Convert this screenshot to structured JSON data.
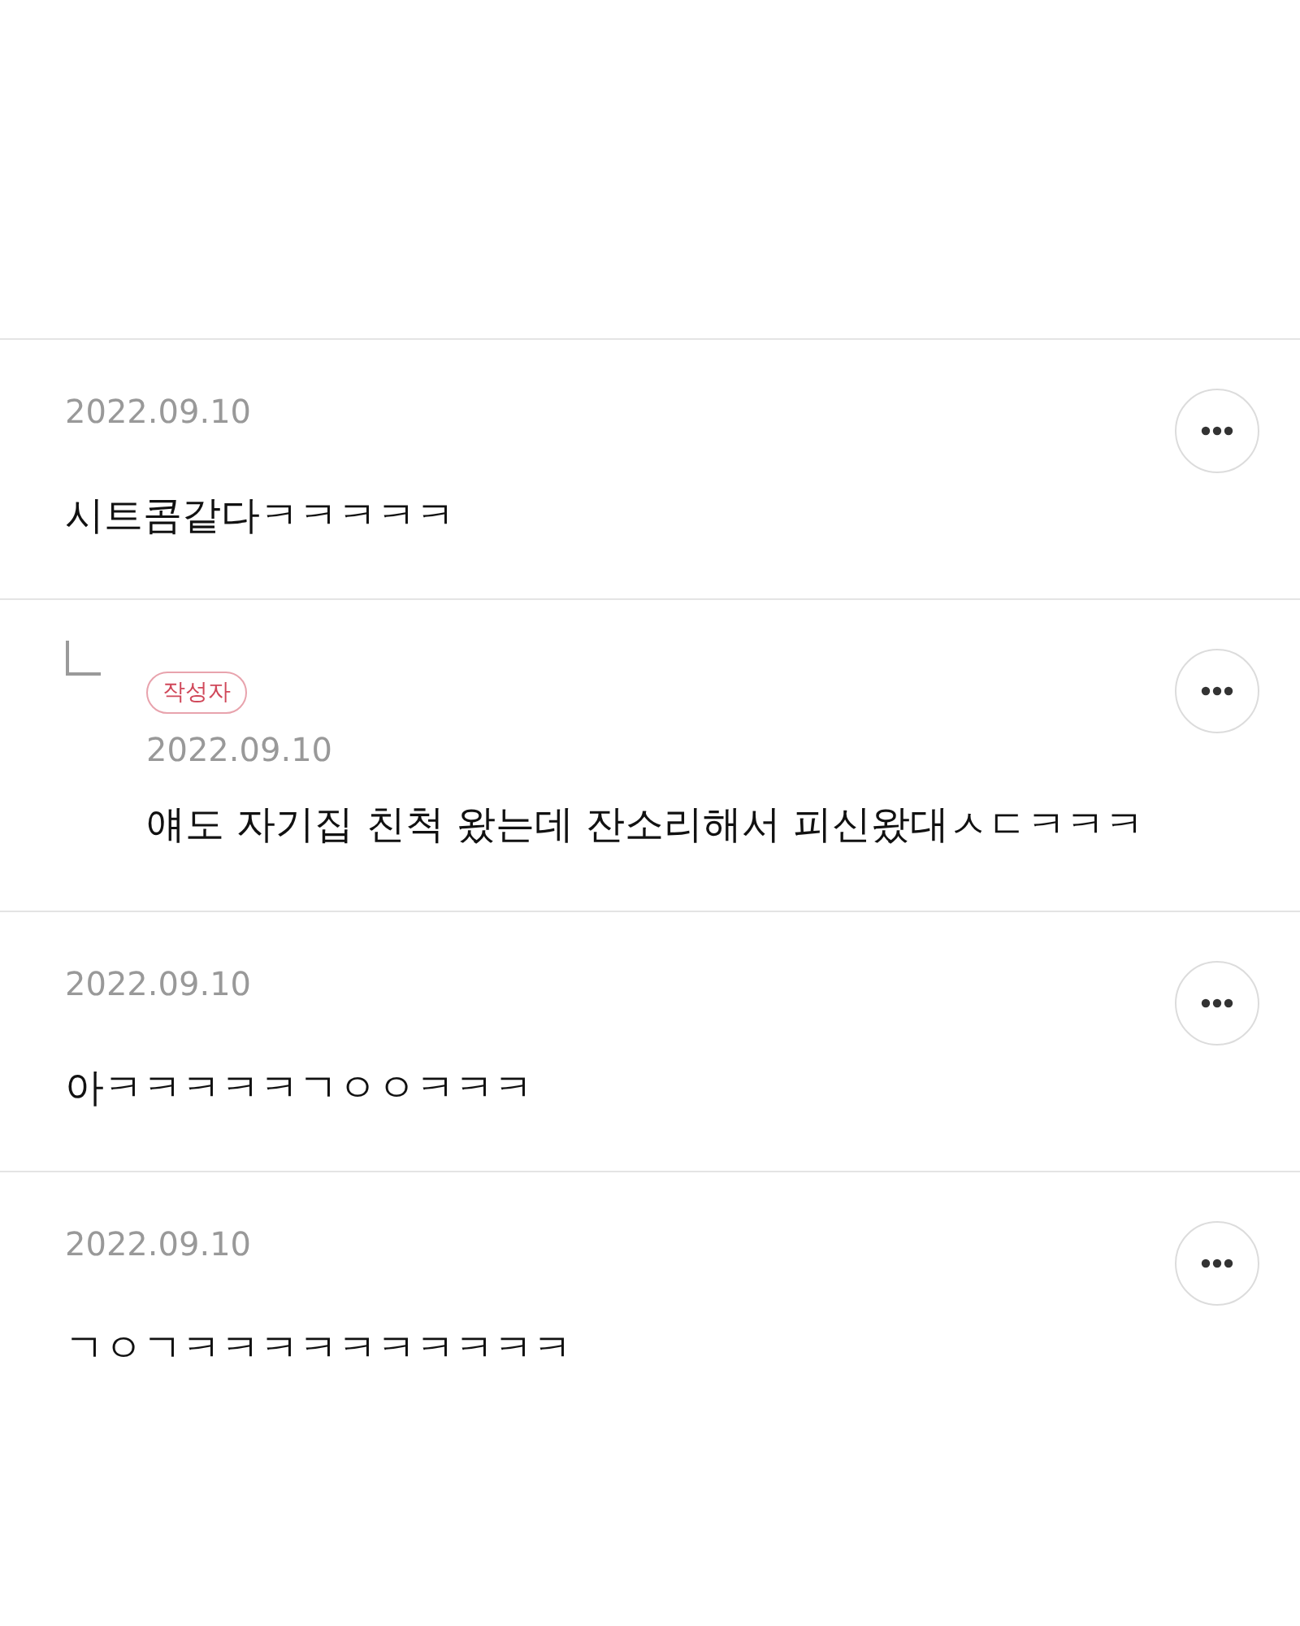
{
  "comments": [
    {
      "kind": "comment",
      "date": "2022.09.10",
      "text": "시트콤같다ㅋㅋㅋㅋㅋ"
    },
    {
      "kind": "reply",
      "badge": "작성자",
      "date": "2022.09.10",
      "text": "얘도 자기집 친척 왔는데 잔소리해서 피신왔대ㅅㄷㅋㅋㅋ"
    },
    {
      "kind": "comment",
      "date": "2022.09.10",
      "text": "아ㅋㅋㅋㅋㅋㄱㅇㅇㅋㅋㅋ"
    },
    {
      "kind": "comment",
      "date": "2022.09.10",
      "text": "ㄱㅇㄱㅋㅋㅋㅋㅋㅋㅋㅋㅋㅋ"
    }
  ]
}
